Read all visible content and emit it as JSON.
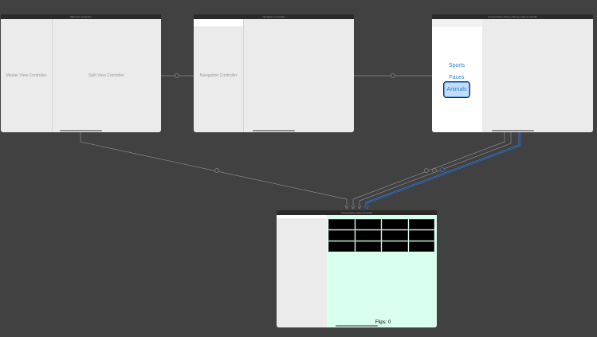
{
  "scenes": {
    "split_view": {
      "title": "Split View Controller",
      "master_label": "Master View Controller",
      "detail_label": "Split View Controller"
    },
    "navigation": {
      "title": "Navigation Controller",
      "label": "Navigation Controller"
    },
    "theme_chooser": {
      "title": "Concentration Theme Chooser View Controller",
      "buttons": [
        "Sports",
        "Faces",
        "Animals"
      ],
      "selected": "Animals"
    },
    "game": {
      "title": "Concentration View Controller",
      "flips_label": "Flips: 0",
      "card_count": 12
    }
  },
  "colors": {
    "canvas": "#414141",
    "scene_background": "#ebebeb",
    "game_background": "#d9ffef",
    "card_back": "#000000",
    "segue_line": "#8a8a8a",
    "segue_selected": "#2f6fd0",
    "button_text": "#2f7fd6"
  }
}
